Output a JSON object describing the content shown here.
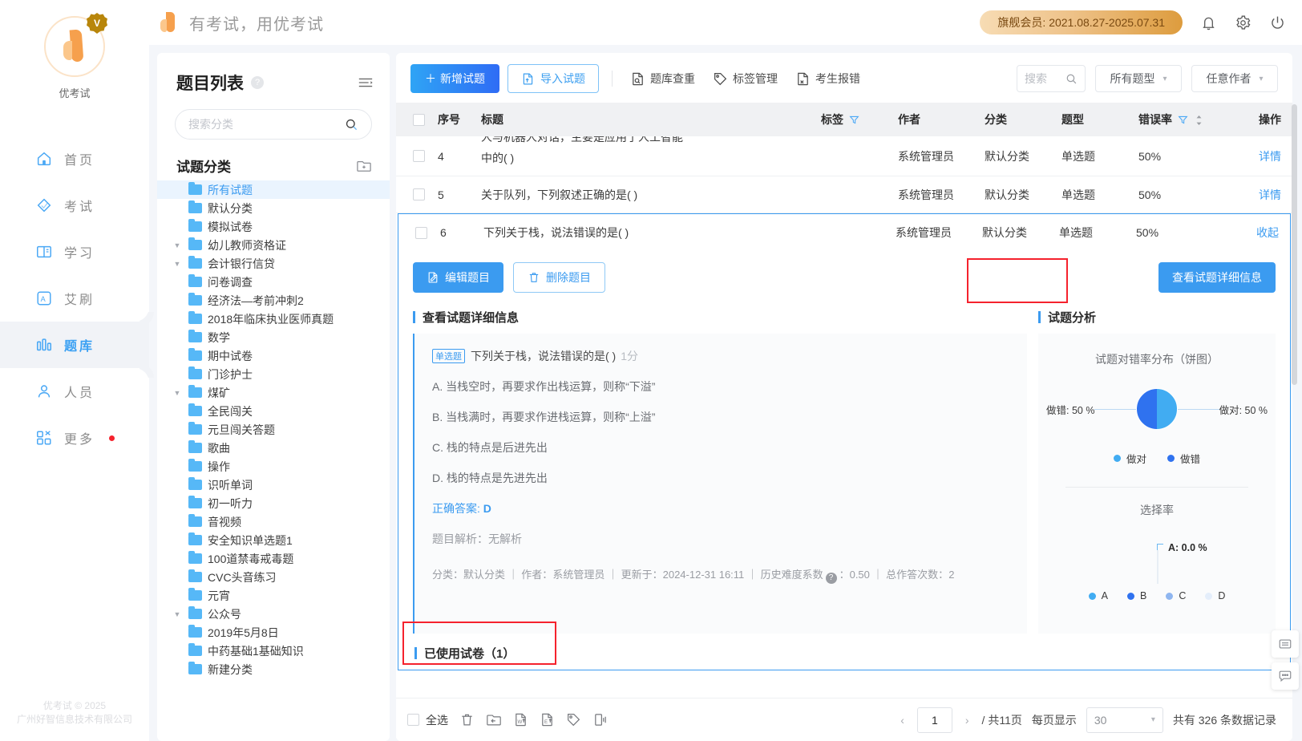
{
  "brand": {
    "logo_name": "优考试",
    "vip_mark": "V",
    "slogan": "有考试，用优考试",
    "footer_line1": "优考试 © 2025",
    "footer_line2": "广州好智信息技术有限公司"
  },
  "topbar": {
    "vip_label": "旗舰会员:",
    "vip_period": "2021.08.27-2025.07.31",
    "icons": [
      "bell-icon",
      "gear-icon",
      "power-icon"
    ]
  },
  "nav": {
    "items": [
      {
        "label": "首页",
        "icon": "home-icon",
        "active": false,
        "dot": false
      },
      {
        "label": "考试",
        "icon": "exam-icon",
        "active": false,
        "dot": false
      },
      {
        "label": "学习",
        "icon": "book-icon",
        "active": false,
        "dot": false
      },
      {
        "label": "艾刷",
        "icon": "ai-brush-icon",
        "active": false,
        "dot": false
      },
      {
        "label": "题库",
        "icon": "bank-icon",
        "active": true,
        "dot": false
      },
      {
        "label": "人员",
        "icon": "user-icon",
        "active": false,
        "dot": false
      },
      {
        "label": "更多",
        "icon": "more-icon",
        "active": false,
        "dot": true
      }
    ]
  },
  "category_panel": {
    "title": "题目列表",
    "help_char": "?",
    "search_placeholder": "搜索分类",
    "search_value": "",
    "sub_title": "试题分类",
    "tree": [
      {
        "label": "所有试题",
        "caret": false,
        "selected": true
      },
      {
        "label": "默认分类",
        "caret": false,
        "selected": false
      },
      {
        "label": "模拟试卷",
        "caret": false,
        "selected": false
      },
      {
        "label": "幼儿教师资格证",
        "caret": true,
        "selected": false
      },
      {
        "label": "会计银行信贷",
        "caret": true,
        "selected": false
      },
      {
        "label": "问卷调查",
        "caret": false,
        "selected": false
      },
      {
        "label": "经济法—考前冲刺2",
        "caret": false,
        "selected": false
      },
      {
        "label": "2018年临床执业医师真题",
        "caret": false,
        "selected": false
      },
      {
        "label": "数学",
        "caret": false,
        "selected": false
      },
      {
        "label": "期中试卷",
        "caret": false,
        "selected": false
      },
      {
        "label": "门诊护士",
        "caret": false,
        "selected": false
      },
      {
        "label": "煤矿",
        "caret": true,
        "selected": false
      },
      {
        "label": "全民闯关",
        "caret": false,
        "selected": false
      },
      {
        "label": "元旦闯关答题",
        "caret": false,
        "selected": false
      },
      {
        "label": "歌曲",
        "caret": false,
        "selected": false
      },
      {
        "label": "操作",
        "caret": false,
        "selected": false
      },
      {
        "label": "识听单词",
        "caret": false,
        "selected": false
      },
      {
        "label": "初一听力",
        "caret": false,
        "selected": false
      },
      {
        "label": "音视频",
        "caret": false,
        "selected": false
      },
      {
        "label": "安全知识单选题1",
        "caret": false,
        "selected": false
      },
      {
        "label": "100道禁毒戒毒题",
        "caret": false,
        "selected": false
      },
      {
        "label": "CVC头音练习",
        "caret": false,
        "selected": false
      },
      {
        "label": "元宵",
        "caret": false,
        "selected": false
      },
      {
        "label": "公众号",
        "caret": true,
        "selected": false
      },
      {
        "label": "2019年5月8日",
        "caret": false,
        "selected": false
      },
      {
        "label": "中药基础1基础知识",
        "caret": false,
        "selected": false
      },
      {
        "label": "新建分类",
        "caret": false,
        "selected": false
      }
    ]
  },
  "toolbar": {
    "add_label": "新增试题",
    "import_label": "导入试题",
    "links": [
      {
        "label": "题库查重",
        "icon": "doc-search-icon"
      },
      {
        "label": "标签管理",
        "icon": "tag-icon"
      },
      {
        "label": "考生报错",
        "icon": "doc-error-icon"
      }
    ],
    "search_placeholder": "搜索",
    "search_value": "",
    "type_filter": "所有题型",
    "author_filter": "任意作者"
  },
  "table": {
    "headers": {
      "no": "序号",
      "title": "标题",
      "tag": "标签",
      "author": "作者",
      "category": "分类",
      "type": "题型",
      "error_rate": "错误率",
      "action": "操作"
    },
    "rows": [
      {
        "no": "4",
        "title_line1": "人与机器人对话，主要是应用了人工智能",
        "title_line2": "中的( )",
        "tag": "",
        "author": "系统管理员",
        "category": "默认分类",
        "type": "单选题",
        "error_rate": "50%",
        "action": "详情",
        "expanded": false,
        "clipped": true
      },
      {
        "no": "5",
        "title_line1": "关于队列，下列叙述正确的是( )",
        "title_line2": "",
        "tag": "",
        "author": "系统管理员",
        "category": "默认分类",
        "type": "单选题",
        "error_rate": "50%",
        "action": "详情",
        "expanded": false,
        "clipped": false
      },
      {
        "no": "6",
        "title_line1": "下列关于栈，说法错误的是( )",
        "title_line2": "",
        "tag": "",
        "author": "系统管理员",
        "category": "默认分类",
        "type": "单选题",
        "error_rate": "50%",
        "action": "收起",
        "expanded": true,
        "clipped": false
      }
    ]
  },
  "detail": {
    "edit_label": "编辑题目",
    "delete_label": "删除题目",
    "view_detail_label": "查看试题详细信息",
    "left_section_title": "查看试题详细信息",
    "right_section_title": "试题分析",
    "question": {
      "type_tag": "单选题",
      "stem": "下列关于栈，说法错误的是( )",
      "score": "1分",
      "options": [
        "A. 当栈空时，再要求作出栈运算，则称“下溢”",
        "B. 当栈满时，再要求作进栈运算，则称“上溢”",
        "C. 栈的特点是后进先出",
        "D. 栈的特点是先进先出"
      ],
      "answer_label": "正确答案:",
      "answer": "D",
      "parse_label": "题目解析：",
      "parse_value": "无解析",
      "meta": {
        "category_label": "分类：",
        "category_value": "默认分类",
        "author_label": "作者：",
        "author_value": "系统管理员",
        "updated_label": "更新于：",
        "updated_value": "2024-12-31 16:11",
        "difficulty_label": "历史难度系数",
        "difficulty_value": "0.50",
        "answered_label": "总作答次数：",
        "answered_value": "2"
      }
    },
    "used_paper_title": "已使用试卷（1）"
  },
  "chart_data": [
    {
      "type": "pie",
      "title": "试题对错率分布（饼图）",
      "categories": [
        "做对",
        "做错"
      ],
      "values": [
        50,
        50
      ],
      "labels": [
        "做对: 50 %",
        "做错: 50 %"
      ],
      "colors": [
        "#41acf2",
        "#2f72ef"
      ],
      "legend_position": "bottom"
    },
    {
      "type": "pie",
      "title": "选择率",
      "categories": [
        "A",
        "B",
        "C",
        "D"
      ],
      "values": [
        0.0,
        0.0,
        0.0,
        0.0
      ],
      "labels": [
        "A: 0.0 %"
      ],
      "colors": [
        "#41acf2",
        "#2f72ef",
        "#8fb6f0",
        "#e4eefb"
      ],
      "legend_position": "bottom"
    }
  ],
  "bottombar": {
    "select_all": "全选",
    "icons": [
      "delete-icon",
      "move-folder-icon",
      "export-word-icon",
      "export-excel-icon",
      "tag-batch-icon",
      "print-icon"
    ],
    "prev": "‹",
    "next": "›",
    "page": "1",
    "page_total": "/ 共11页",
    "per_page_label": "每页显示",
    "per_page_value": "30",
    "total_text": "共有 326 条数据记录"
  },
  "fabs": [
    "list-widget-icon",
    "chat-widget-icon"
  ]
}
